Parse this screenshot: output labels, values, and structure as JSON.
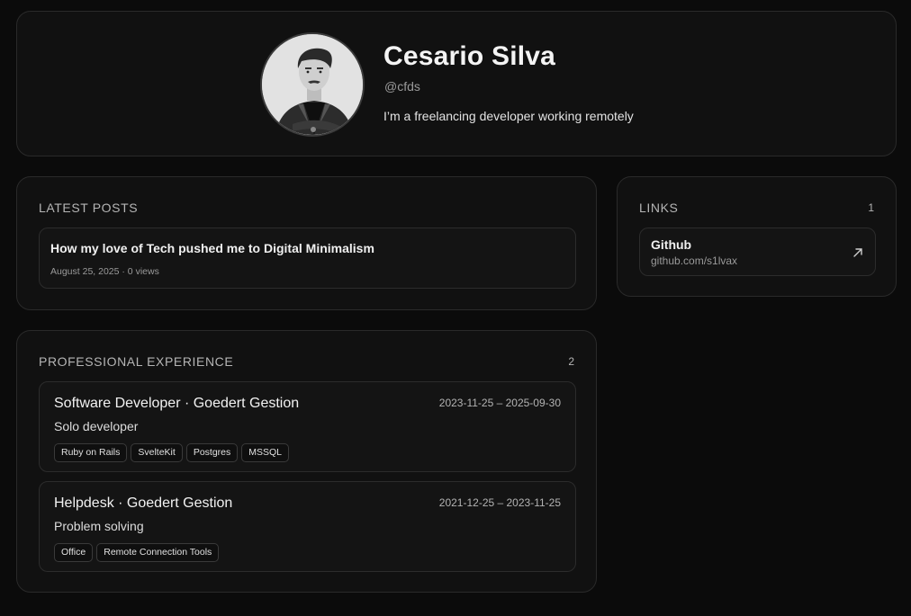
{
  "profile": {
    "name": "Cesario Silva",
    "handle": "@cfds",
    "bio": "I’m a freelancing developer working remotely"
  },
  "posts": {
    "title": "LATEST POSTS",
    "items": [
      {
        "title": "How my love of Tech pushed me to Digital Minimalism",
        "meta": "August 25, 2025 · 0 views"
      }
    ]
  },
  "links": {
    "title": "LINKS",
    "count": "1",
    "items": [
      {
        "label": "Github",
        "url": "github.com/s1lvax",
        "icon": "arrow-up-right-icon"
      }
    ]
  },
  "experience": {
    "title": "PROFESSIONAL EXPERIENCE",
    "count": "2",
    "items": [
      {
        "title": "Software Developer · Goedert Gestion",
        "dates": "2023-11-25 – 2025-09-30",
        "description": "Solo developer",
        "tags": [
          "Ruby on Rails",
          "SvelteKit",
          "Postgres",
          "MSSQL"
        ]
      },
      {
        "title": "Helpdesk · Goedert Gestion",
        "dates": "2021-12-25 – 2023-11-25",
        "description": "Problem solving",
        "tags": [
          "Office",
          "Remote Connection Tools"
        ]
      }
    ]
  }
}
